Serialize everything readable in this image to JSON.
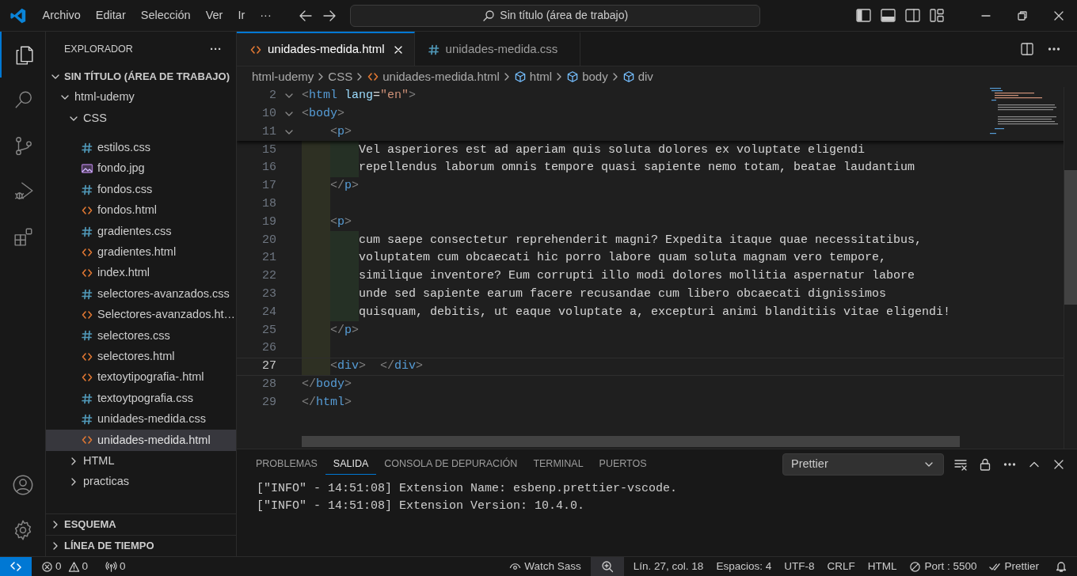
{
  "title_bar": {
    "menu": [
      "Archivo",
      "Editar",
      "Selección",
      "Ver",
      "Ir",
      "···"
    ],
    "search": "Sin título (área de trabajo)"
  },
  "activity_bar": {
    "top": [
      {
        "kind": "explorer",
        "selected": true
      },
      {
        "kind": "search",
        "selected": false
      },
      {
        "kind": "source-control",
        "selected": false
      },
      {
        "kind": "run-debug",
        "selected": false
      },
      {
        "kind": "extensions",
        "selected": false
      }
    ],
    "bottom": [
      {
        "kind": "account"
      },
      {
        "kind": "settings"
      }
    ]
  },
  "sidebar": {
    "title": "EXPLORADOR",
    "more": "···",
    "workspace": {
      "title": "SIN TÍTULO (ÁREA DE TRABAJO)",
      "expanded": true,
      "children": [
        {
          "name": "html-udemy",
          "kind": "folder",
          "expanded": true,
          "selected": false,
          "children": [
            {
              "name": "CSS",
              "kind": "folder",
              "expanded": true,
              "selected": false,
              "children": [
                {
                  "name": "estilos.css",
                  "kind": "css",
                  "selected": false
                },
                {
                  "name": "fondo.jpg",
                  "kind": "image",
                  "selected": false
                },
                {
                  "name": "fondos.css",
                  "kind": "css",
                  "selected": false
                },
                {
                  "name": "fondos.html",
                  "kind": "html",
                  "selected": false
                },
                {
                  "name": "gradientes.css",
                  "kind": "css",
                  "selected": false
                },
                {
                  "name": "gradientes.html",
                  "kind": "html",
                  "selected": false
                },
                {
                  "name": "index.html",
                  "kind": "html",
                  "selected": false
                },
                {
                  "name": "selectores-avanzados.css",
                  "kind": "css",
                  "selected": false
                },
                {
                  "name": "Selectores-avanzados.ht…",
                  "kind": "html",
                  "selected": false
                },
                {
                  "name": "selectores.css",
                  "kind": "css",
                  "selected": false
                },
                {
                  "name": "selectores.html",
                  "kind": "html",
                  "selected": false
                },
                {
                  "name": "textoytipografia-.html",
                  "kind": "html",
                  "selected": false
                },
                {
                  "name": "textoytpografia.css",
                  "kind": "css",
                  "selected": false
                },
                {
                  "name": "unidades-medida.css",
                  "kind": "css",
                  "selected": false
                },
                {
                  "name": "unidades-medida.html",
                  "kind": "html",
                  "selected": true
                }
              ]
            },
            {
              "name": "HTML",
              "kind": "folder",
              "expanded": false,
              "selected": false
            },
            {
              "name": "practicas",
              "kind": "folder",
              "expanded": false,
              "selected": false
            }
          ]
        }
      ]
    },
    "sections": [
      {
        "title": "ESQUEMA",
        "expanded": false
      },
      {
        "title": "LÍNEA DE TIEMPO",
        "expanded": false
      }
    ]
  },
  "tabs": [
    {
      "label": "unidades-medida.html",
      "kind": "html",
      "selected": true
    },
    {
      "label": "unidades-medida.css",
      "kind": "css",
      "selected": false
    }
  ],
  "breadcrumbs": [
    {
      "label": "html-udemy",
      "kind": "folder"
    },
    {
      "label": "CSS",
      "kind": "folder"
    },
    {
      "label": "unidades-medida.html",
      "kind": "html"
    },
    {
      "label": "html",
      "kind": "element"
    },
    {
      "label": "body",
      "kind": "element"
    },
    {
      "label": "div",
      "kind": "element"
    }
  ],
  "sticky_lines": [
    {
      "number": "2",
      "foldable": true,
      "current": false,
      "tokens": [
        {
          "kind": "punct",
          "text": "<"
        },
        {
          "kind": "tag",
          "text": "html"
        },
        {
          "kind": "attr",
          "text": " lang"
        },
        {
          "kind": "text",
          "text": "="
        },
        {
          "kind": "string",
          "text": "\"en\""
        },
        {
          "kind": "punct",
          "text": ">"
        }
      ]
    },
    {
      "number": "10",
      "foldable": true,
      "current": false,
      "tokens": [
        {
          "kind": "punct",
          "text": "<"
        },
        {
          "kind": "tag",
          "text": "body"
        },
        {
          "kind": "punct",
          "text": ">"
        }
      ]
    },
    {
      "number": "11",
      "foldable": true,
      "current": false,
      "tokens": [
        {
          "kind": "punct",
          "text": "    <"
        },
        {
          "kind": "tag",
          "text": "p"
        },
        {
          "kind": "punct",
          "text": ">"
        }
      ]
    }
  ],
  "lines": [
    {
      "number": "15",
      "foldable": false,
      "current": false,
      "tokens": [
        {
          "kind": "text",
          "text": "        Vel asperiores est ad aperiam quis soluta dolores ex voluptate eligendi"
        }
      ]
    },
    {
      "number": "16",
      "foldable": false,
      "current": false,
      "tokens": [
        {
          "kind": "text",
          "text": "        repellendus laborum omnis tempore quasi sapiente nemo totam, beatae laudantium"
        }
      ]
    },
    {
      "number": "17",
      "foldable": false,
      "current": false,
      "tokens": [
        {
          "kind": "punct",
          "text": "    </"
        },
        {
          "kind": "tag",
          "text": "p"
        },
        {
          "kind": "punct",
          "text": ">"
        }
      ]
    },
    {
      "number": "18",
      "foldable": false,
      "current": false
    },
    {
      "number": "19",
      "foldable": false,
      "current": false,
      "tokens": [
        {
          "kind": "punct",
          "text": "    <"
        },
        {
          "kind": "tag",
          "text": "p"
        },
        {
          "kind": "punct",
          "text": ">"
        }
      ]
    },
    {
      "number": "20",
      "foldable": false,
      "current": false,
      "tokens": [
        {
          "kind": "text",
          "text": "        cum saepe consectetur reprehenderit magni? Expedita itaque quae necessitatibus,"
        }
      ]
    },
    {
      "number": "21",
      "foldable": false,
      "current": false,
      "tokens": [
        {
          "kind": "text",
          "text": "        voluptatem cum obcaecati hic porro labore quam soluta magnam vero tempore,"
        }
      ]
    },
    {
      "number": "22",
      "foldable": false,
      "current": false,
      "tokens": [
        {
          "kind": "text",
          "text": "        similique inventore? Eum corrupti illo modi dolores mollitia aspernatur labore"
        }
      ]
    },
    {
      "number": "23",
      "foldable": false,
      "current": false,
      "tokens": [
        {
          "kind": "text",
          "text": "        unde sed sapiente earum facere recusandae cum libero obcaecati dignissimos"
        }
      ]
    },
    {
      "number": "24",
      "foldable": false,
      "current": false,
      "tokens": [
        {
          "kind": "text",
          "text": "        quisquam, debitis, ut eaque voluptate a, excepturi animi blanditiis vitae eligendi!"
        }
      ]
    },
    {
      "number": "25",
      "foldable": false,
      "current": false,
      "tokens": [
        {
          "kind": "punct",
          "text": "    </"
        },
        {
          "kind": "tag",
          "text": "p"
        },
        {
          "kind": "punct",
          "text": ">"
        }
      ]
    },
    {
      "number": "26",
      "foldable": false,
      "current": false
    },
    {
      "number": "27",
      "foldable": false,
      "current": true,
      "tokens": [
        {
          "kind": "punct",
          "text": "    <"
        },
        {
          "kind": "tag",
          "text": "div"
        },
        {
          "kind": "punct",
          "text": ">  </"
        },
        {
          "kind": "tag",
          "text": "div"
        },
        {
          "kind": "punct",
          "text": ">"
        }
      ]
    },
    {
      "number": "28",
      "foldable": false,
      "current": false,
      "tokens": [
        {
          "kind": "punct",
          "text": "</"
        },
        {
          "kind": "tag",
          "text": "body"
        },
        {
          "kind": "punct",
          "text": ">"
        }
      ]
    },
    {
      "number": "29",
      "foldable": false,
      "current": false,
      "tokens": [
        {
          "kind": "punct",
          "text": "</"
        },
        {
          "kind": "tag",
          "text": "html"
        },
        {
          "kind": "punct",
          "text": ">"
        }
      ]
    }
  ],
  "panel": {
    "tabs": [
      {
        "label": "PROBLEMAS",
        "selected": false
      },
      {
        "label": "SALIDA",
        "selected": true
      },
      {
        "label": "CONSOLA DE DEPURACIÓN",
        "selected": false
      },
      {
        "label": "TERMINAL",
        "selected": false
      },
      {
        "label": "PUERTOS",
        "selected": false
      }
    ],
    "channel": "Prettier",
    "output": [
      "[\"INFO\" - 14:51:08] Extension Name: esbenp.prettier-vscode.",
      "[\"INFO\" - 14:51:08] Extension Version: 10.4.0."
    ]
  },
  "status_bar": {
    "left": [
      {
        "kind": "errors",
        "text": "0"
      },
      {
        "kind": "warnings",
        "text": "0"
      },
      {
        "kind": "ports",
        "text": "0"
      }
    ],
    "right": [
      {
        "kind": "eye",
        "text": "Watch Sass"
      },
      {
        "kind": "zoom"
      },
      {
        "kind": "plain",
        "text": "Lín. 27, col. 18"
      },
      {
        "kind": "plain",
        "text": "Espacios: 4"
      },
      {
        "kind": "plain",
        "text": "UTF-8"
      },
      {
        "kind": "plain",
        "text": "CRLF"
      },
      {
        "kind": "plain",
        "text": "HTML"
      },
      {
        "kind": "blocked",
        "text": "Port : 5500"
      },
      {
        "kind": "check-all",
        "text": "Prettier"
      },
      {
        "kind": "bell"
      }
    ]
  }
}
